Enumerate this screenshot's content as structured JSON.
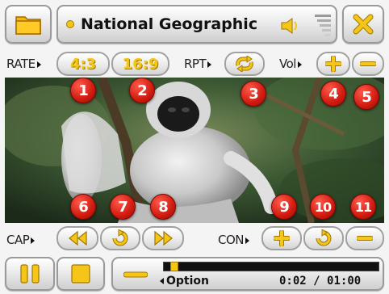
{
  "header": {
    "channel_title": "National Geographic",
    "icons": {
      "folder": "folder-icon",
      "close": "close-icon",
      "speaker": "speaker-icon",
      "signal": "signal-bars-icon"
    }
  },
  "row1": {
    "rate_label": "RATE",
    "rate_4_3": "4:3",
    "rate_16_9": "16:9",
    "repeat_label": "RPT",
    "vol_label": "Vol"
  },
  "row2": {
    "cap_label": "CAP",
    "con_label": "CON"
  },
  "badges": [
    "1",
    "2",
    "3",
    "4",
    "5",
    "6",
    "7",
    "8",
    "9",
    "10",
    "11"
  ],
  "player": {
    "option_label": "Option",
    "time_current": "0:02",
    "time_separator": "/",
    "time_total": "01:00",
    "progress_fraction": 0.03
  },
  "colors": {
    "accent_yellow": "#f5c518",
    "badge_red": "#d01b10",
    "progress_fill": "#f5c518",
    "progress_track": "#111111"
  }
}
